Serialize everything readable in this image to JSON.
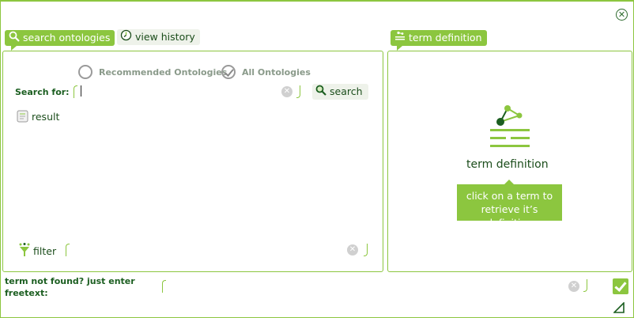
{
  "window": {
    "close_icon": "close-icon"
  },
  "tabs": {
    "search_ontologies": "search ontologies",
    "view_history": "view history",
    "term_definition": "term definition"
  },
  "search": {
    "option_recommended": "Recommended Ontologies",
    "option_all": "All Ontologies",
    "selected_option": "All Ontologies",
    "search_for_label": "Search for:",
    "input_value": "",
    "search_button": "search",
    "result_label": "result"
  },
  "filter": {
    "label": "filter",
    "input_value": ""
  },
  "definition": {
    "title": "term definition",
    "hint": "click on a term to retrieve it’s definition"
  },
  "freetext": {
    "label": "term not found? just enter freetext:",
    "input_value": ""
  },
  "colors": {
    "accent": "#8cc63f",
    "dark_green": "#1b5e20",
    "text_green": "#1b4d1b"
  }
}
